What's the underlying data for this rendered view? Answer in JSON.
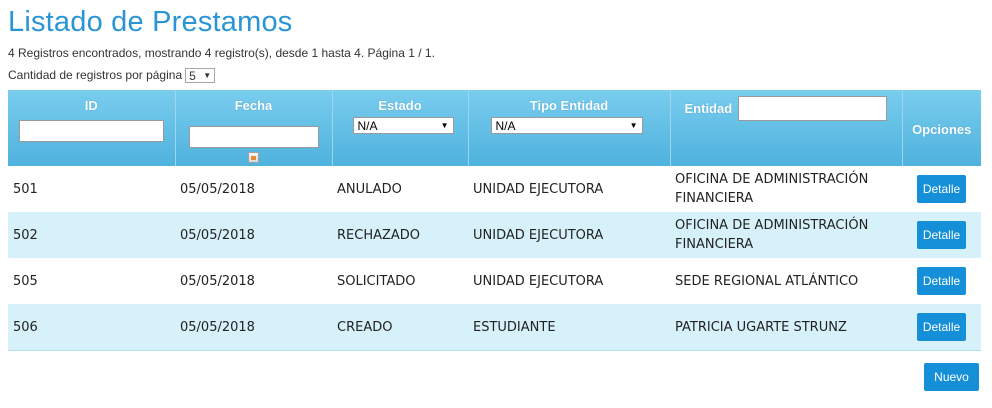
{
  "page": {
    "title": "Listado de Prestamos",
    "summary": "4 Registros encontrados, mostrando 4 registro(s), desde 1 hasta 4. Página 1 / 1.",
    "per_page_label": "Cantidad de registros por página",
    "per_page_value": "5"
  },
  "table": {
    "headers": {
      "id": "ID",
      "fecha": "Fecha",
      "estado": "Estado",
      "tipo_entidad": "Tipo Entidad",
      "entidad": "Entidad",
      "opciones": "Opciones"
    },
    "filters": {
      "estado_value": "N/A",
      "tipo_entidad_value": "N/A"
    },
    "rows": [
      {
        "id": "501",
        "fecha": "05/05/2018",
        "estado": "ANULADO",
        "tipo_entidad": "UNIDAD EJECUTORA",
        "entidad": "OFICINA DE ADMINISTRACIÓN FINANCIERA",
        "action": "Detalle"
      },
      {
        "id": "502",
        "fecha": "05/05/2018",
        "estado": "RECHAZADO",
        "tipo_entidad": "UNIDAD EJECUTORA",
        "entidad": "OFICINA DE ADMINISTRACIÓN FINANCIERA",
        "action": "Detalle"
      },
      {
        "id": "505",
        "fecha": "05/05/2018",
        "estado": "SOLICITADO",
        "tipo_entidad": "UNIDAD EJECUTORA",
        "entidad": "SEDE REGIONAL ATLÁNTICO",
        "action": "Detalle"
      },
      {
        "id": "506",
        "fecha": "05/05/2018",
        "estado": "CREADO",
        "tipo_entidad": "ESTUDIANTE",
        "entidad": "PATRICIA UGARTE STRUNZ",
        "action": "Detalle"
      }
    ]
  },
  "actions": {
    "new_label": "Nuevo"
  },
  "colors": {
    "title": "#2a95d6",
    "header_bg": "#5bbde4",
    "row_alt_bg": "#d7f1fa",
    "button_bg": "#1590d8"
  },
  "icons": {
    "date_picker": "calendar-icon",
    "dropdown": "chevron-down-icon"
  }
}
